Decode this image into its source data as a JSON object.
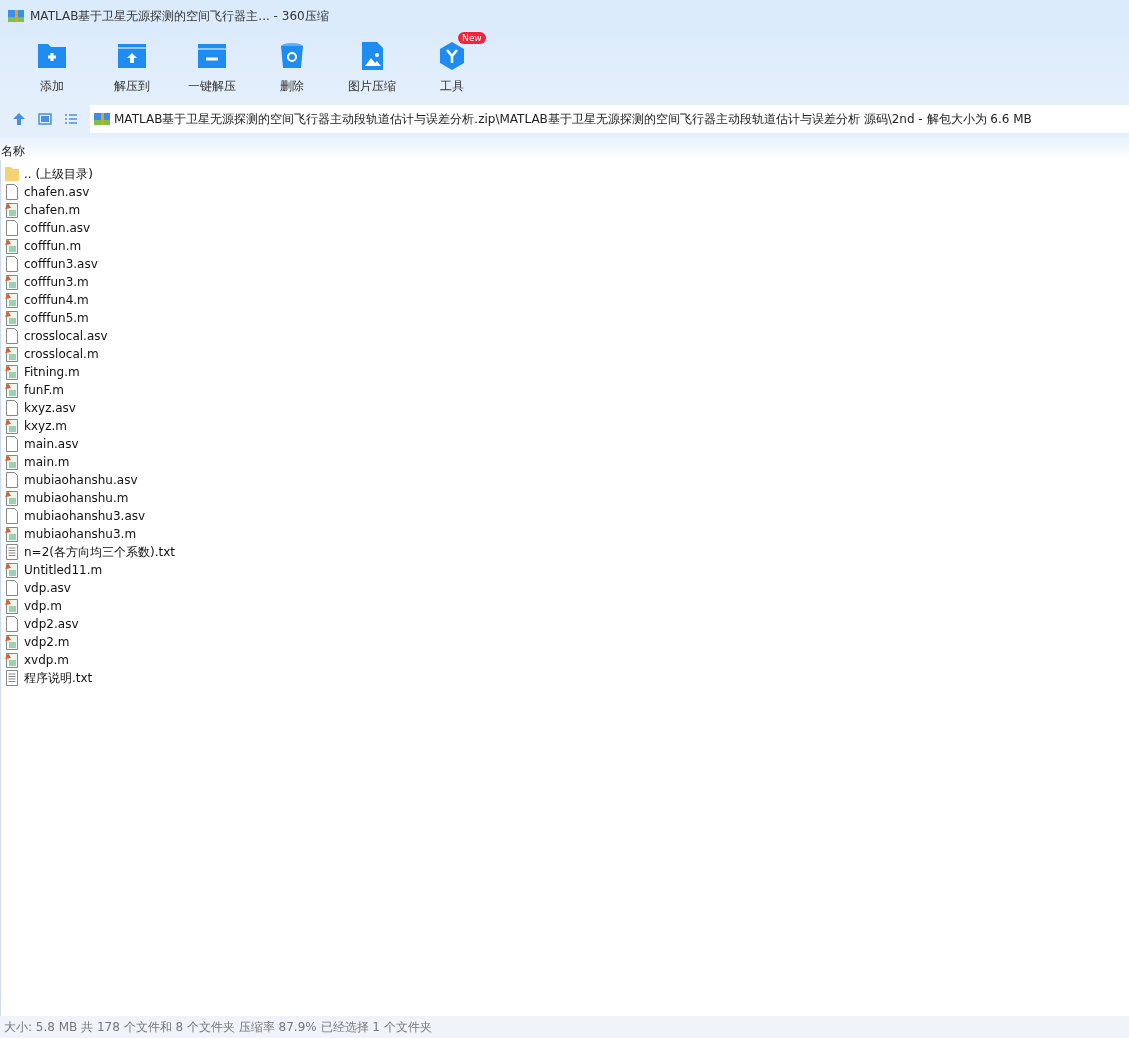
{
  "window": {
    "title": "MATLAB基于卫星无源探测的空间飞行器主... - 360压缩"
  },
  "toolbar": [
    {
      "kind": "add",
      "label": "添加"
    },
    {
      "kind": "extract",
      "label": "解压到"
    },
    {
      "kind": "extract-one",
      "label": "一键解压"
    },
    {
      "kind": "delete",
      "label": "删除"
    },
    {
      "kind": "image",
      "label": "图片压缩"
    },
    {
      "kind": "tools",
      "label": "工具",
      "badge": "New"
    }
  ],
  "address": {
    "path": "MATLAB基于卫星无源探测的空间飞行器主动段轨道估计与误差分析.zip\\MATLAB基于卫星无源探测的空间飞行器主动段轨道估计与误差分析 源码\\2nd - 解包大小为 6.6 MB"
  },
  "table": {
    "columns": [
      "名称"
    ],
    "rows": [
      {
        "kind": "folder",
        "name": ".. (上级目录)"
      },
      {
        "kind": "file",
        "name": "chafen.asv"
      },
      {
        "kind": "matlab",
        "name": "chafen.m"
      },
      {
        "kind": "file",
        "name": "cofffun.asv"
      },
      {
        "kind": "matlab",
        "name": "cofffun.m"
      },
      {
        "kind": "file",
        "name": "cofffun3.asv"
      },
      {
        "kind": "matlab",
        "name": "cofffun3.m"
      },
      {
        "kind": "matlab",
        "name": "cofffun4.m"
      },
      {
        "kind": "matlab",
        "name": "cofffun5.m"
      },
      {
        "kind": "file",
        "name": "crosslocal.asv"
      },
      {
        "kind": "matlab",
        "name": "crosslocal.m"
      },
      {
        "kind": "matlab",
        "name": "Fitning.m"
      },
      {
        "kind": "matlab",
        "name": "funF.m"
      },
      {
        "kind": "file",
        "name": "kxyz.asv"
      },
      {
        "kind": "matlab",
        "name": "kxyz.m"
      },
      {
        "kind": "file",
        "name": "main.asv"
      },
      {
        "kind": "matlab",
        "name": "main.m"
      },
      {
        "kind": "file",
        "name": "mubiaohanshu.asv"
      },
      {
        "kind": "matlab",
        "name": "mubiaohanshu.m"
      },
      {
        "kind": "file",
        "name": "mubiaohanshu3.asv"
      },
      {
        "kind": "matlab",
        "name": "mubiaohanshu3.m"
      },
      {
        "kind": "text",
        "name": "n=2(各方向均三个系数).txt"
      },
      {
        "kind": "matlab",
        "name": "Untitled11.m"
      },
      {
        "kind": "file",
        "name": "vdp.asv"
      },
      {
        "kind": "matlab",
        "name": "vdp.m"
      },
      {
        "kind": "file",
        "name": "vdp2.asv"
      },
      {
        "kind": "matlab",
        "name": "vdp2.m"
      },
      {
        "kind": "matlab",
        "name": "xvdp.m"
      },
      {
        "kind": "text",
        "name": "程序说明.txt"
      }
    ]
  },
  "status_bar": "大小: 5.8 MB 共 178 个文件和 8 个文件夹 压缩率 87.9% 已经选择 1 个文件夹"
}
